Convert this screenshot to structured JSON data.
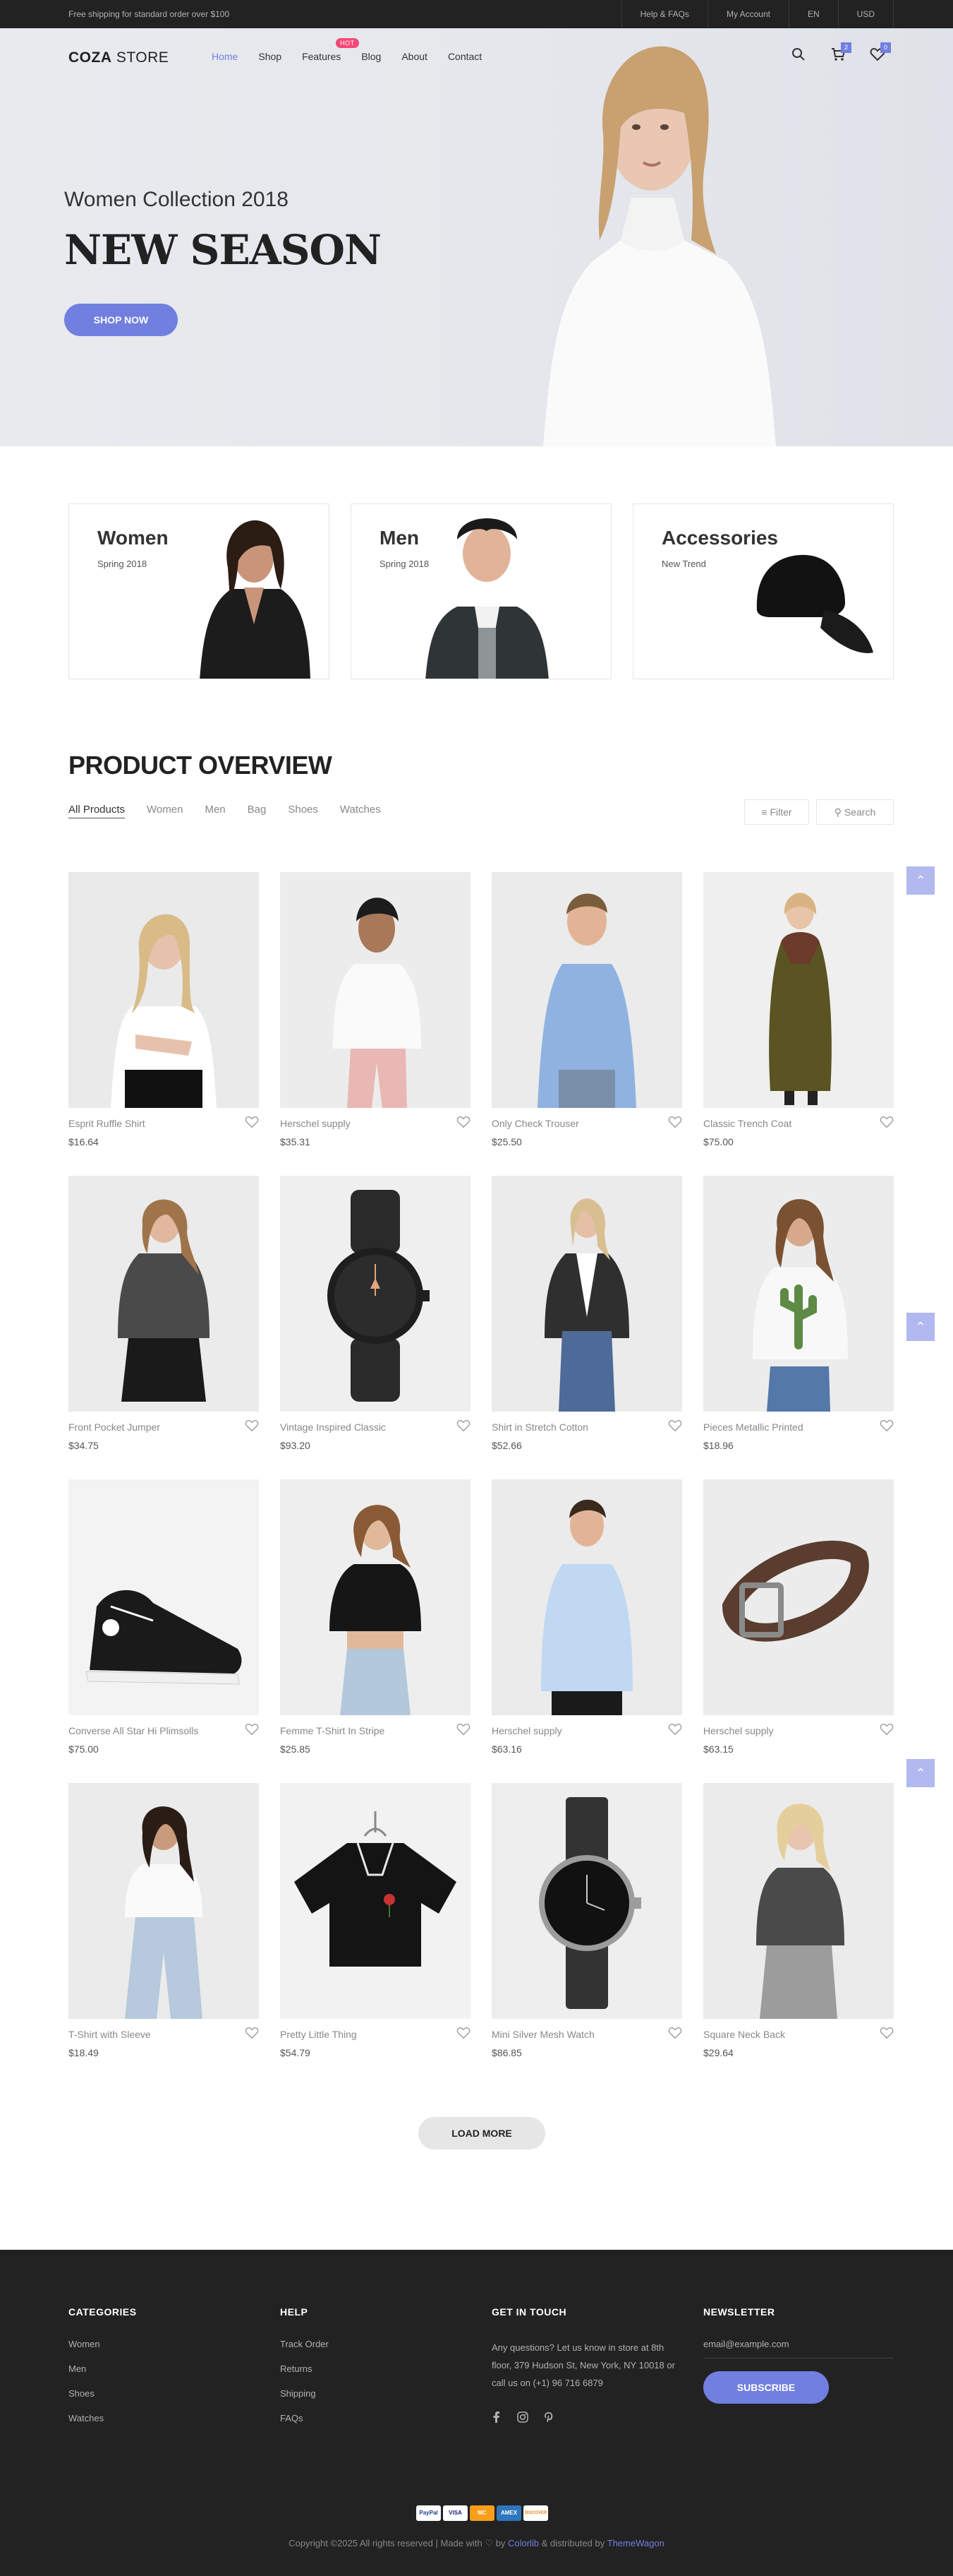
{
  "topbar": {
    "shipping": "Free shipping for standard order over $100",
    "links": [
      "Help & FAQs",
      "My Account",
      "EN",
      "USD"
    ]
  },
  "nav": {
    "logo_bold": "COZA",
    "logo_light": " STORE",
    "menu": [
      "Home",
      "Shop",
      "Features",
      "Blog",
      "About",
      "Contact"
    ],
    "hot_badge": "HOT",
    "cart_count": "2",
    "wishlist_count": "0"
  },
  "hero": {
    "subtitle": "Women Collection 2018",
    "title": "NEW SEASON",
    "cta": "SHOP NOW"
  },
  "banners": [
    {
      "title": "Women",
      "subtitle": "Spring 2018"
    },
    {
      "title": "Men",
      "subtitle": "Spring 2018"
    },
    {
      "title": "Accessories",
      "subtitle": "New Trend"
    }
  ],
  "overview": {
    "title": "PRODUCT OVERVIEW",
    "filters": [
      "All Products",
      "Women",
      "Men",
      "Bag",
      "Shoes",
      "Watches"
    ],
    "filter_button": "Filter",
    "search_button": "Search",
    "load_more": "LOAD MORE"
  },
  "products": [
    {
      "name": "Esprit Ruffle Shirt",
      "price": "$16.64"
    },
    {
      "name": "Herschel supply",
      "price": "$35.31"
    },
    {
      "name": "Only Check Trouser",
      "price": "$25.50"
    },
    {
      "name": "Classic Trench Coat",
      "price": "$75.00"
    },
    {
      "name": "Front Pocket Jumper",
      "price": "$34.75"
    },
    {
      "name": "Vintage Inspired Classic",
      "price": "$93.20"
    },
    {
      "name": "Shirt in Stretch Cotton",
      "price": "$52.66"
    },
    {
      "name": "Pieces Metallic Printed",
      "price": "$18.96"
    },
    {
      "name": "Converse All Star Hi Plimsolls",
      "price": "$75.00"
    },
    {
      "name": "Femme T-Shirt In Stripe",
      "price": "$25.85"
    },
    {
      "name": "Herschel supply",
      "price": "$63.16"
    },
    {
      "name": "Herschel supply",
      "price": "$63.15"
    },
    {
      "name": "T-Shirt with Sleeve",
      "price": "$18.49"
    },
    {
      "name": "Pretty Little Thing",
      "price": "$54.79"
    },
    {
      "name": "Mini Silver Mesh Watch",
      "price": "$86.85"
    },
    {
      "name": "Square Neck Back",
      "price": "$29.64"
    }
  ],
  "footer": {
    "categories": {
      "title": "CATEGORIES",
      "items": [
        "Women",
        "Men",
        "Shoes",
        "Watches"
      ]
    },
    "help": {
      "title": "HELP",
      "items": [
        "Track Order",
        "Returns",
        "Shipping",
        "FAQs"
      ]
    },
    "contact": {
      "title": "GET IN TOUCH",
      "text": "Any questions? Let us know in store at 8th floor, 379 Hudson St, New York, NY 10018 or call us on (+1) 96 716 6879"
    },
    "newsletter": {
      "title": "NEWSLETTER",
      "placeholder": "email@example.com",
      "button": "SUBSCRIBE"
    },
    "payments": [
      "PayPal",
      "VISA",
      "MC",
      "AMEX",
      "DISCOVER"
    ],
    "copyright_pre": "Copyright ©2025 All rights reserved | Made with ♡ by ",
    "copyright_link1": "Colorlib",
    "copyright_mid": " & distributed by ",
    "copyright_link2": "ThemeWagon"
  },
  "colors": {
    "accent": "#717fe0",
    "hot": "#f74877",
    "dark": "#222222"
  }
}
